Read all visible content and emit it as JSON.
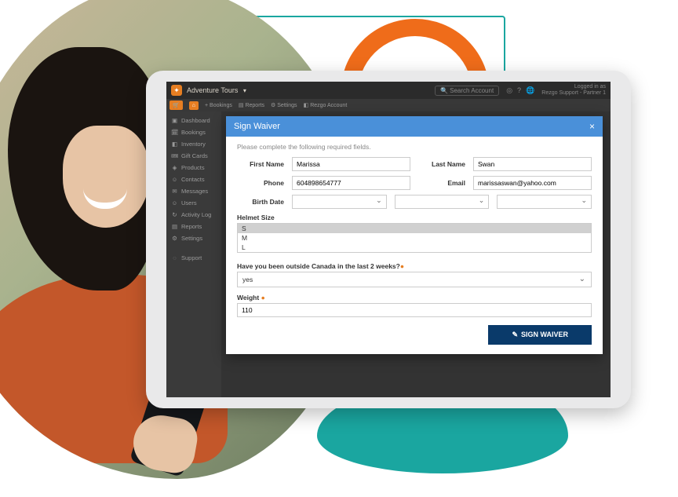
{
  "app": {
    "title": "Adventure Tours",
    "search_placeholder": "Search Account",
    "user_line1": "Logged in as",
    "user_line2": "Rezgo Support - Partner 1"
  },
  "toolbar": {
    "bookings": "Bookings",
    "reports": "Reports",
    "settings": "Settings",
    "account": "Rezgo Account"
  },
  "sidebar": {
    "items": [
      {
        "icon": "▣",
        "label": "Dashboard"
      },
      {
        "icon": "🗓",
        "label": "Bookings"
      },
      {
        "icon": "◧",
        "label": "Inventory"
      },
      {
        "icon": "🎟",
        "label": "Gift Cards"
      },
      {
        "icon": "◈",
        "label": "Products"
      },
      {
        "icon": "☺",
        "label": "Contacts"
      },
      {
        "icon": "✉",
        "label": "Messages"
      },
      {
        "icon": "☺",
        "label": "Users"
      },
      {
        "icon": "↻",
        "label": "Activity Log"
      },
      {
        "icon": "▤",
        "label": "Reports"
      },
      {
        "icon": "⚙",
        "label": "Settings"
      },
      {
        "icon": "◌",
        "label": "Support"
      }
    ]
  },
  "modal": {
    "title": "Sign Waiver",
    "instruction": "Please complete the following required fields.",
    "labels": {
      "first_name": "First Name",
      "last_name": "Last Name",
      "phone": "Phone",
      "email": "Email",
      "birth_date": "Birth Date",
      "helmet_size": "Helmet Size",
      "canada_q": "Have you been outside Canada in the last 2 weeks?",
      "weight": "Weight"
    },
    "values": {
      "first_name": "Marissa",
      "last_name": "Swan",
      "phone": "604898654777",
      "email": "marissaswan@yahoo.com",
      "canada_a": "yes",
      "weight": "110"
    },
    "helmet_options": [
      "S",
      "M",
      "L"
    ],
    "helmet_selected": "S",
    "submit_label": "SIGN WAIVER"
  }
}
